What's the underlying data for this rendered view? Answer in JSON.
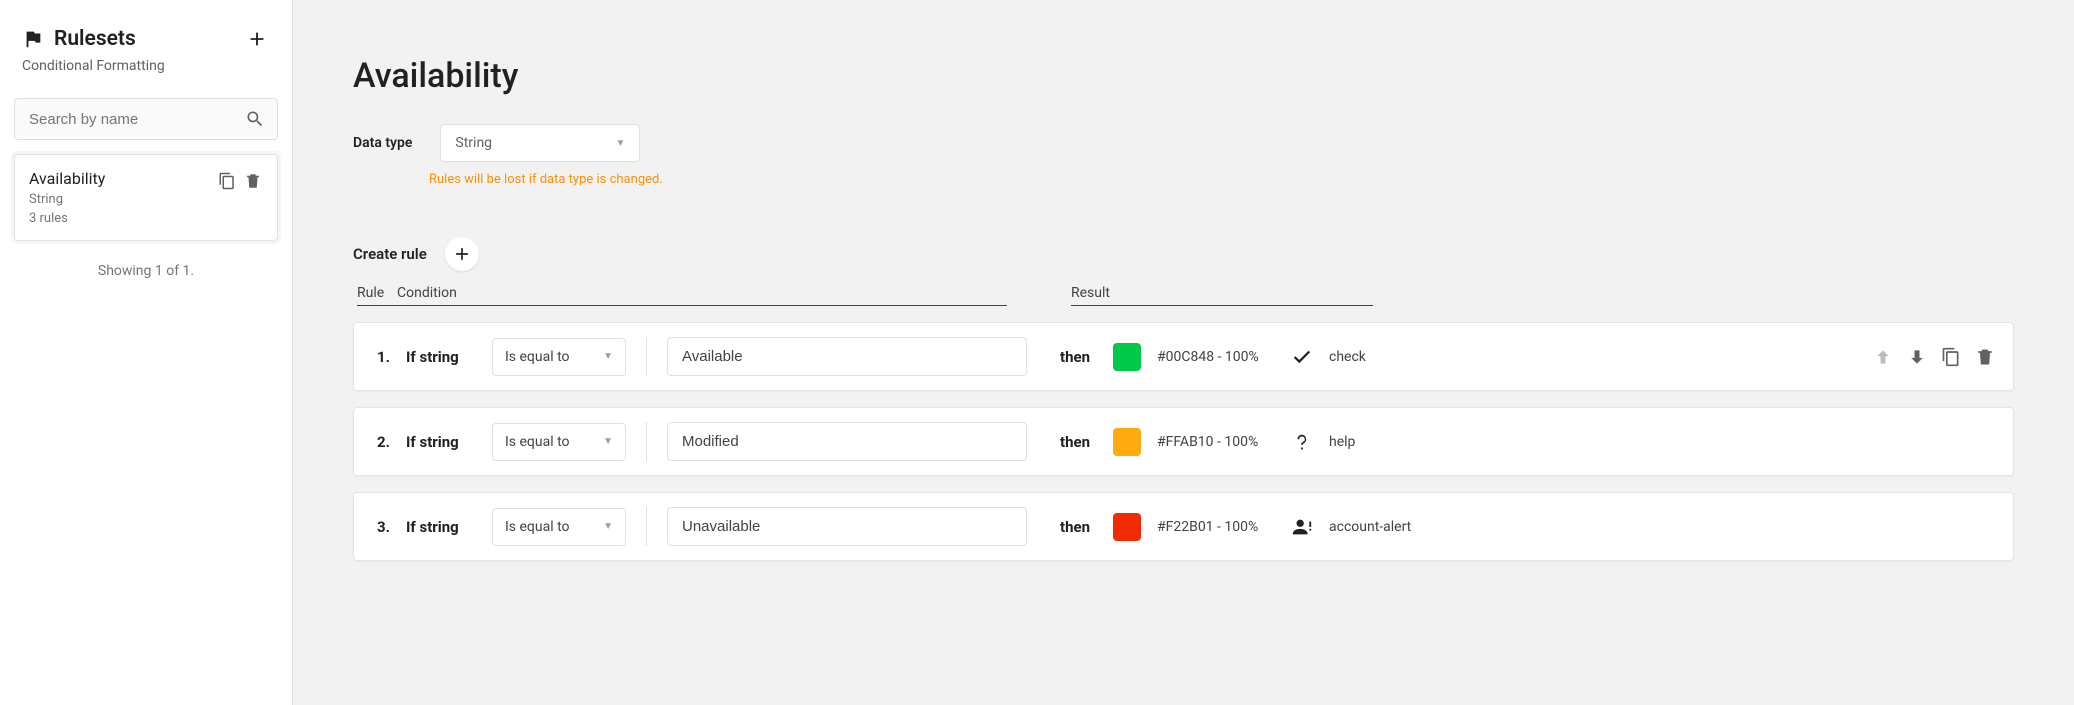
{
  "sidebar": {
    "title": "Rulesets",
    "subtitle": "Conditional Formatting",
    "search_placeholder": "Search by name",
    "footer": "Showing 1 of 1.",
    "items": [
      {
        "name": "Availability",
        "type": "String",
        "count": "3 rules"
      }
    ]
  },
  "main": {
    "title": "Availability",
    "data_type_label": "Data type",
    "data_type_value": "String",
    "data_type_warning": "Rules will be lost if data type is changed.",
    "create_label": "Create rule",
    "headers": {
      "rule": "Rule",
      "condition": "Condition",
      "result": "Result"
    },
    "rules": [
      {
        "index": "1.",
        "if_label": "If string",
        "op": "Is equal to",
        "value": "Available",
        "then": "then",
        "color_hex": "#00C848",
        "color_text": "#00C848 - 100%",
        "icon_key": "check",
        "icon_name": "check",
        "show_actions": true
      },
      {
        "index": "2.",
        "if_label": "If string",
        "op": "Is equal to",
        "value": "Modified",
        "then": "then",
        "color_hex": "#FFAB10",
        "color_text": "#FFAB10 - 100%",
        "icon_key": "help",
        "icon_name": "help",
        "show_actions": false
      },
      {
        "index": "3.",
        "if_label": "If string",
        "op": "Is equal to",
        "value": "Unavailable",
        "then": "then",
        "color_hex": "#F22B01",
        "color_text": "#F22B01 - 100%",
        "icon_key": "account-alert",
        "icon_name": "account-alert",
        "show_actions": false
      }
    ]
  }
}
